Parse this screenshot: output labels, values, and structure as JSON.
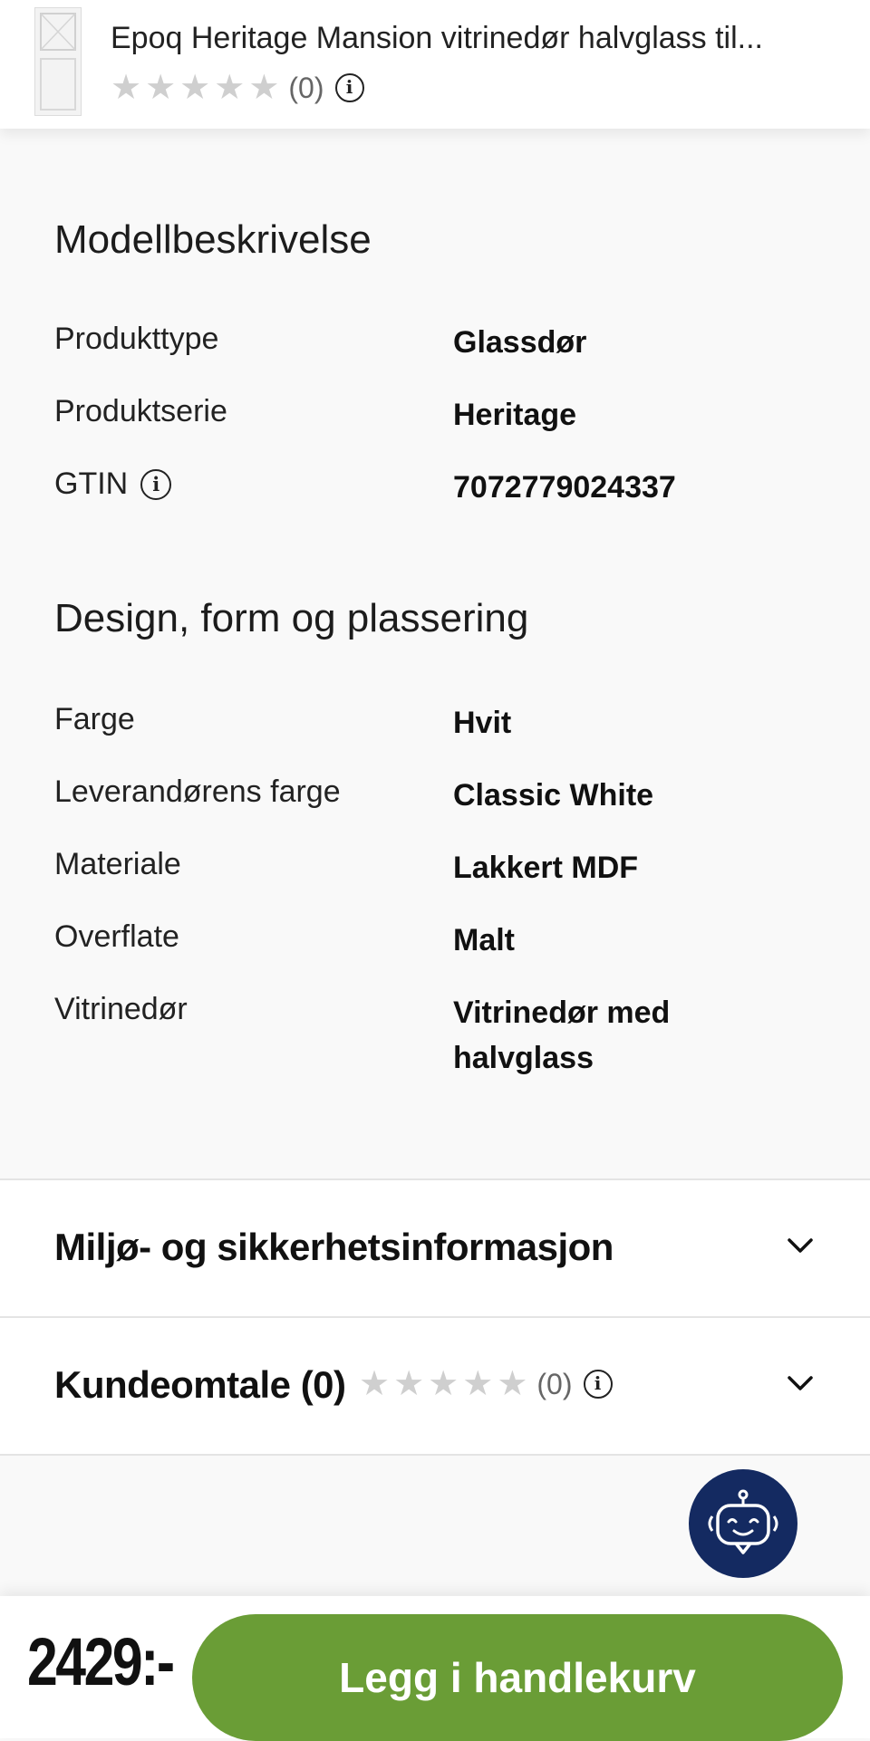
{
  "header": {
    "product_title": "Epoq Heritage Mansion vitrinedør halvglass til...",
    "rating_count": "(0)",
    "thumbnail_icon": "door-thumbnail"
  },
  "model_description": {
    "title": "Modellbeskrivelse",
    "rows": [
      {
        "label": "Produkttype",
        "value": "Glassdør"
      },
      {
        "label": "Produktserie",
        "value": "Heritage"
      },
      {
        "label": "GTIN",
        "value": "7072779024337"
      }
    ]
  },
  "design": {
    "title": "Design, form og plassering",
    "rows": [
      {
        "label": "Farge",
        "value": "Hvit"
      },
      {
        "label": "Leverandørens farge",
        "value": "Classic White"
      },
      {
        "label": "Materiale",
        "value": "Lakkert MDF"
      },
      {
        "label": "Overflate",
        "value": "Malt"
      },
      {
        "label": "Vitrinedør",
        "value": "Vitrinedør med halvglass"
      }
    ]
  },
  "accordions": {
    "environment": {
      "title": "Miljø- og sikkerhetsinformasjon"
    },
    "reviews": {
      "title": "Kundeomtale (0)",
      "rating_count": "(0)"
    }
  },
  "footer": {
    "price": "2429:-",
    "cart_button_label": "Legg i handlekurv",
    "button_color": "#6a9d36"
  },
  "chat": {
    "icon": "chatbot-icon",
    "color": "#142a61"
  }
}
